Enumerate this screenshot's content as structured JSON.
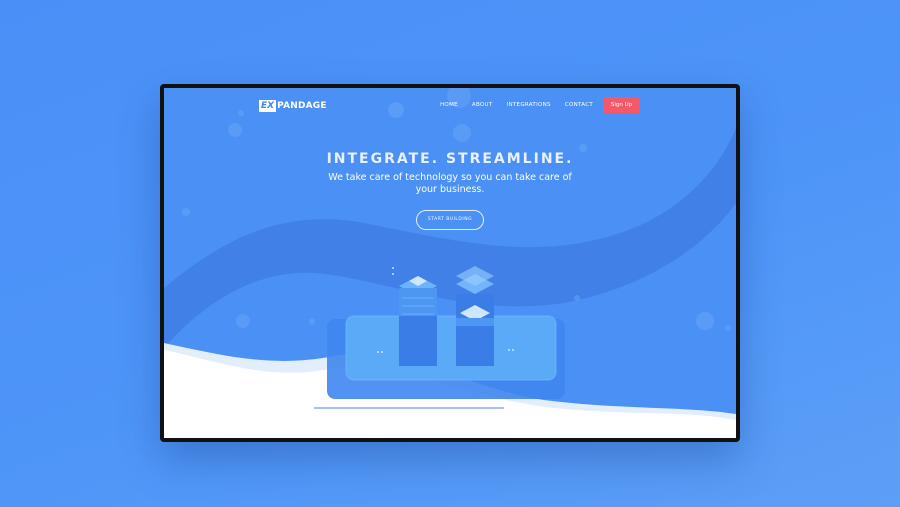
{
  "brand": {
    "logo_mark": "EX",
    "logo_text": "PANDAGE"
  },
  "nav": {
    "items": [
      "HOME",
      "ABOUT",
      "INTEGRATIONS",
      "CONTACT"
    ],
    "signup_label": "Sign Up"
  },
  "hero": {
    "title": "INTEGRATE. STREAMLINE.",
    "subtitle": "We take care of technology so you can take care of your business.",
    "cta_label": "START BUILDING"
  },
  "colors": {
    "page_bg": "#4e95f8",
    "hero_bg": "#4a90f5",
    "wave_dark": "#3f7fe4",
    "signup": "#f55869",
    "foreground_wave": "#ffffff"
  },
  "icons": [
    "server-stack-illustration",
    "platform-illustration"
  ]
}
